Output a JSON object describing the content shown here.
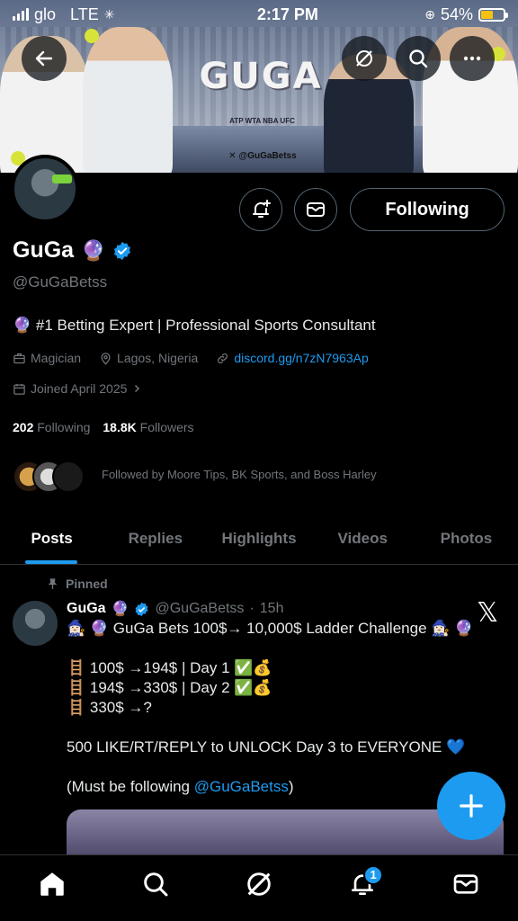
{
  "status_bar": {
    "carrier": "glo",
    "network": "LTE",
    "time": "2:17 PM",
    "battery": "54%",
    "battery_level": 0.54
  },
  "banner": {
    "brand": "GUGA",
    "sub": "ATP WTA NBA UFC",
    "handle": "@GuGaBetss"
  },
  "profile": {
    "name": "GuGa",
    "handle": "@GuGaBetss",
    "bio": "#1 Betting Expert | Professional Sports Consultant",
    "category": "Magician",
    "location": "Lagos, Nigeria",
    "link": "discord.gg/n7zN7963Ap",
    "joined": "Joined April 2025",
    "following_count": "202",
    "following_label": "Following",
    "followers_count": "18.8K",
    "followers_label": "Followers",
    "followed_by": "Followed by Moore Tips, BK Sports, and Boss Harley",
    "follow_button": "Following"
  },
  "tabs": [
    "Posts",
    "Replies",
    "Highlights",
    "Videos",
    "Photos"
  ],
  "post": {
    "pinned_label": "Pinned",
    "author": "GuGa",
    "handle": "@GuGaBetss",
    "time": "15h",
    "title": "🧙🏻‍♀️ 🔮 GuGa Bets 100$→ 10,000$ Ladder Challenge 🧙🏻‍♀️ 🔮",
    "line1": "🪜 100$ →194$ | Day 1 ✅💰",
    "line2": "🪜 194$ →330$ | Day 2 ✅💰",
    "line3": "🪜 330$ →?",
    "cta": "500 LIKE/RT/REPLY to UNLOCK Day 3 to EVERYONE 💙",
    "follow_note_prefix": "(Must be following ",
    "follow_note_mention": "@GuGaBetss",
    "follow_note_suffix": ")"
  },
  "notifications_badge": "1",
  "colors": {
    "accent": "#1d9bf0",
    "background": "#000000",
    "muted": "#71767b"
  }
}
